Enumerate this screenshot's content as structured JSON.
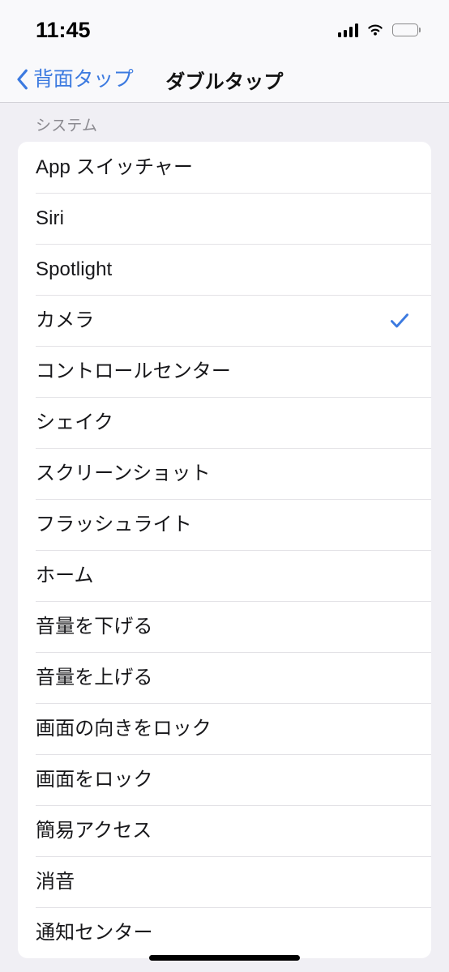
{
  "status_bar": {
    "time": "11:45",
    "cellular_icon": "cellular-signal-icon",
    "wifi_icon": "wifi-icon",
    "battery_icon": "battery-full-icon"
  },
  "nav_bar": {
    "back_icon": "chevron-left-icon",
    "back_label": "背面タップ",
    "title": "ダブルタップ"
  },
  "colors": {
    "accent_blue": "#3c7ae0",
    "background": "#f0eff4",
    "card": "#ffffff",
    "separator": "#e3e2e6",
    "header_text": "#8b8a90",
    "row_text": "#17171a"
  },
  "section": {
    "header": "システム",
    "rows": [
      {
        "label": "App スイッチャー",
        "selected": false
      },
      {
        "label": "Siri",
        "selected": false
      },
      {
        "label": "Spotlight",
        "selected": false
      },
      {
        "label": "カメラ",
        "selected": true
      },
      {
        "label": "コントロールセンター",
        "selected": false
      },
      {
        "label": "シェイク",
        "selected": false
      },
      {
        "label": "スクリーンショット",
        "selected": false
      },
      {
        "label": "フラッシュライト",
        "selected": false
      },
      {
        "label": "ホーム",
        "selected": false
      },
      {
        "label": "音量を下げる",
        "selected": false
      },
      {
        "label": "音量を上げる",
        "selected": false
      },
      {
        "label": "画面の向きをロック",
        "selected": false
      },
      {
        "label": "画面をロック",
        "selected": false
      },
      {
        "label": "簡易アクセス",
        "selected": false
      },
      {
        "label": "消音",
        "selected": false
      },
      {
        "label": "通知センター",
        "selected": false
      }
    ],
    "selected_checkmark_icon": "checkmark-icon"
  },
  "home_indicator": "home-indicator"
}
